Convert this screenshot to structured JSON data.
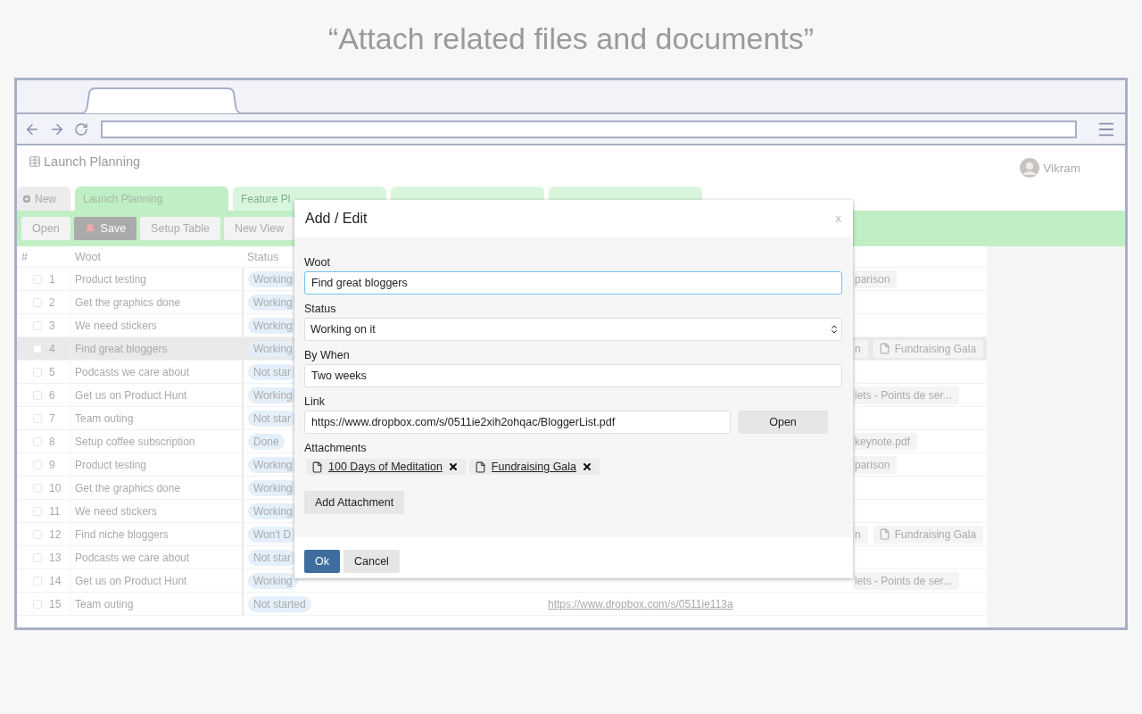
{
  "headline": "“Attach related files and documents”",
  "app": {
    "title": "Launch Planning",
    "user": "Vikram"
  },
  "tabs": [
    {
      "label": "New",
      "kind": "new",
      "selected": false
    },
    {
      "label": "Launch Planning",
      "kind": "sheet",
      "selected": true
    },
    {
      "label": "Feature Pl",
      "kind": "sheet",
      "selected": false
    },
    {
      "kind": "sheet",
      "selected": false
    },
    {
      "kind": "sheet",
      "selected": false
    }
  ],
  "toolbar": [
    {
      "label": "Open",
      "kind": "plain"
    },
    {
      "label": "Save",
      "kind": "alert"
    },
    {
      "label": "Setup Table",
      "kind": "plain"
    },
    {
      "label": "New View",
      "kind": "plain"
    }
  ],
  "table": {
    "columns": [
      "#",
      "Woot",
      "Status"
    ],
    "rows": [
      {
        "number": "1",
        "woot": "Product testing",
        "status": "Working",
        "checked": false,
        "selected": false,
        "attachments": [
          {
            "name": "parison",
            "kind": "fragment"
          }
        ]
      },
      {
        "number": "2",
        "woot": "Get the graphics done",
        "status": "Working",
        "checked": false,
        "selected": false,
        "attachments": []
      },
      {
        "number": "3",
        "woot": "We need stickers",
        "status": "Working",
        "checked": false,
        "selected": false,
        "attachments": []
      },
      {
        "number": "4",
        "woot": "Find great bloggers",
        "status": "Working",
        "checked": false,
        "selected": true,
        "attachments": [
          {
            "name": "n",
            "kind": "fragment"
          },
          {
            "name": "Fundraising Gala",
            "kind": "file"
          }
        ]
      },
      {
        "number": "5",
        "woot": "Podcasts we care about",
        "status": "Not star",
        "checked": false,
        "selected": false,
        "attachments": []
      },
      {
        "number": "6",
        "woot": "Get us on Product Hunt",
        "status": "Working",
        "checked": false,
        "selected": false,
        "attachments": [
          {
            "name": "lets - Points de ser...",
            "kind": "fragment"
          }
        ]
      },
      {
        "number": "7",
        "woot": "Team outing",
        "status": "Not star",
        "checked": false,
        "selected": false,
        "attachments": []
      },
      {
        "number": "8",
        "woot": "Setup coffee subscription",
        "status": "Done",
        "checked": false,
        "selected": false,
        "attachments": [
          {
            "name": "keynote.pdf",
            "kind": "fragment"
          }
        ]
      },
      {
        "number": "9",
        "woot": "Product testing",
        "status": "Working",
        "checked": false,
        "selected": false,
        "attachments": [
          {
            "name": "parison",
            "kind": "fragment"
          }
        ]
      },
      {
        "number": "10",
        "woot": "Get the graphics done",
        "status": "Working",
        "checked": false,
        "selected": false,
        "attachments": []
      },
      {
        "number": "11",
        "woot": "We need stickers",
        "status": "Working",
        "checked": false,
        "selected": false,
        "attachments": []
      },
      {
        "number": "12",
        "woot": "Find niche bloggers",
        "status": "Won't D",
        "checked": false,
        "selected": false,
        "attachments": [
          {
            "name": "n",
            "kind": "fragment"
          },
          {
            "name": "Fundraising Gala",
            "kind": "file"
          }
        ]
      },
      {
        "number": "13",
        "woot": "Podcasts we care about",
        "status": "Not star",
        "checked": false,
        "selected": false,
        "attachments": []
      },
      {
        "number": "14",
        "woot": "Get us on Product Hunt",
        "status": "Working",
        "checked": false,
        "selected": false,
        "attachments": [
          {
            "name": "lets - Points de ser...",
            "kind": "fragment"
          }
        ]
      },
      {
        "number": "15",
        "woot": "Team outing",
        "status": "Not started",
        "checked": false,
        "selected": false,
        "link": "https://www.dropbox.com/s/0511ie113a",
        "attachments": []
      }
    ]
  },
  "dialog": {
    "title": "Add / Edit",
    "close": "x",
    "fields": [
      {
        "label": "Woot",
        "kind": "text",
        "value": "Find great bloggers",
        "focused": true
      },
      {
        "label": "Status",
        "kind": "select",
        "value": "Working on it",
        "focused": false
      },
      {
        "label": "By When",
        "kind": "text",
        "value": "Two weeks",
        "focused": false
      },
      {
        "label": "Link",
        "kind": "link",
        "value": "https://www.dropbox.com/s/0511ie2xih2ohqac/BloggerList.pdf",
        "button": "Open",
        "focused": false
      }
    ],
    "attachments": {
      "label": "Attachments",
      "items": [
        "100 Days of Meditation",
        "Fundraising Gala"
      ],
      "add_button": "Add Attachment"
    },
    "buttons": [
      {
        "label": "Ok",
        "kind": "primary"
      },
      {
        "label": "Cancel",
        "kind": "secondary"
      }
    ]
  }
}
